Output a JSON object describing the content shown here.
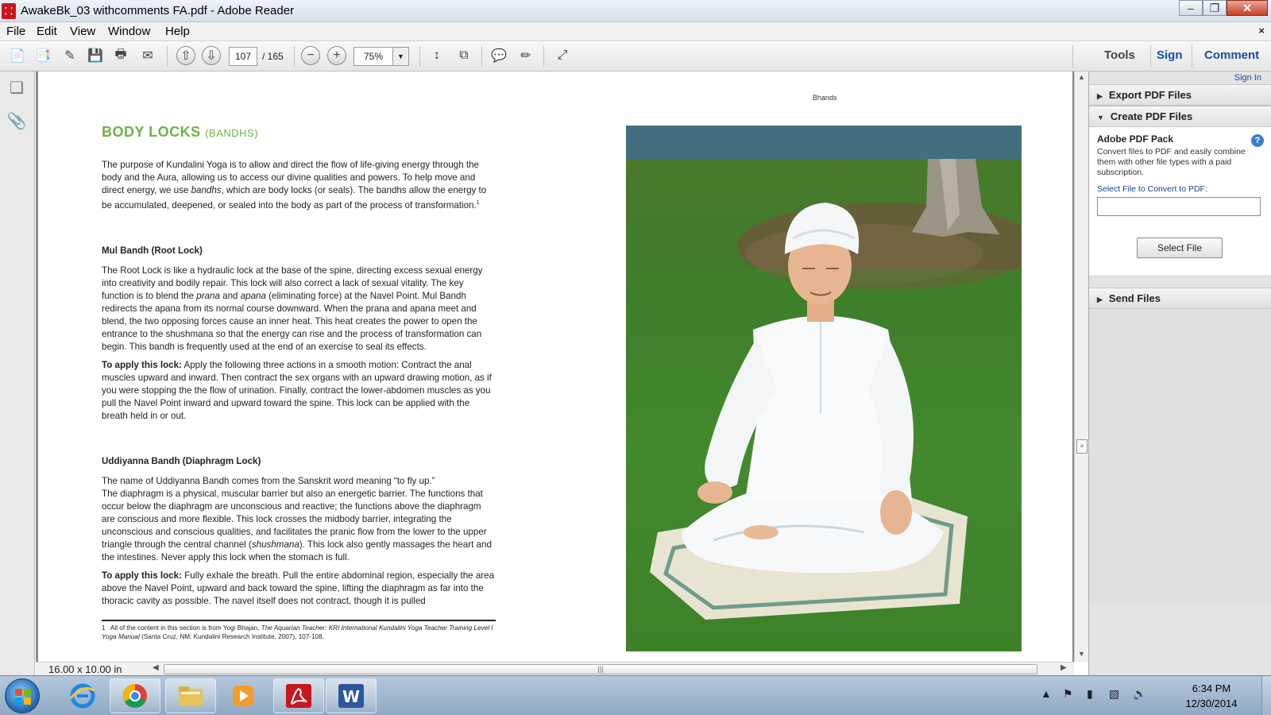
{
  "window": {
    "title": "AwakeBk_03 withcomments FA.pdf - Adobe Reader",
    "app_icon": "adobe-pdf-icon",
    "controls": [
      "minimize",
      "restore",
      "close"
    ]
  },
  "menu": {
    "items": [
      "File",
      "Edit",
      "View",
      "Window",
      "Help"
    ],
    "close_glyph": "×"
  },
  "toolbar": {
    "page_current": "107",
    "page_total": "/ 165",
    "zoom": "75%",
    "tools_label": "Tools",
    "sign_label": "Sign",
    "comment_label": "Comment"
  },
  "document": {
    "running_head": "Bhands",
    "title": "BODY LOCKS",
    "title_sub": "(BANDHS)",
    "intro_1": "The purpose of Kundalini Yoga is to allow and direct the flow of life-giving energy through the body and the Aura, allowing us to access our divine qualities and powers. To help move and direct energy, we use ",
    "intro_em": "bandhs",
    "intro_2": ", which are body locks (or seals). The bandhs allow the energy to be accumulated, deepened, or sealed into the body as part of the process of transformation.",
    "intro_sup": "1",
    "mul_heading": "Mul Bandh (Root Lock)",
    "mul_p1_a": "The Root Lock is like a hydraulic lock at the base of the spine, directing excess sexual energy into creativity and bodily repair. This lock will also correct a lack of sexual vitality. The key function is to blend the ",
    "mul_p1_em1": "prana",
    "mul_p1_b": " and ",
    "mul_p1_em2": "apana",
    "mul_p1_c": " (eliminating force) at the Navel Point. Mul Bandh redirects the apana from its normal course downward. When the prana and apana meet and blend, the two opposing forces cause an inner heat. This heat creates the power to open the entrance to the shushmana so that the energy can rise and the process of transformation can begin. This bandh is frequently used at the end of an exercise to seal its effects.",
    "mul_apply_label": "To apply this lock:",
    "mul_apply_text": " Apply the following three actions in a smooth motion: Contract the anal muscles upward and inward. Then contract the sex organs with an upward drawing motion, as if you were stopping the the flow of urination. Finally, contract the lower-abdomen muscles as you pull the Navel Point inward and upward toward the spine. This lock can be applied with the breath held in or out.",
    "udd_heading": "Uddiyanna Bandh (Diaphragm Lock)",
    "udd_p1": "The name of Uddiyanna Bandh comes from the Sanskrit word meaning “to fly up.”",
    "udd_p2_a": "The diaphragm is a physical, muscular barrier but also an energetic barrier. The functions that occur below the diaphragm are unconscious and reactive; the functions above the diaphragm are conscious and more flexible. This lock crosses the midbody barrier, integrating the unconscious and conscious qualities, and facilitates the pranic flow from the lower to the upper triangle through the central channel (",
    "udd_p2_em": "shushmana",
    "udd_p2_b": "). This lock also gently massages the heart and the intestines. Never apply this lock when the stomach is full.",
    "udd_apply_label": "To apply this lock:",
    "udd_apply_text": " Fully exhale the breath. Pull the entire abdominal region, especially the area above the Navel Point, upward and back toward the spine, lifting the diaphragm as far into the thoracic cavity as possible. The navel itself does not contract, though it is pulled",
    "footnote_num": "1",
    "footnote_a": "All of the content in this section is from Yogi Bhajan, ",
    "footnote_em": "The Aquarian Teacher: KRI International Kundalini Yoga Teacher Training Level I Yoga Manual",
    "footnote_b": " (Santa Cruz, NM: Kundalini Research Institute, 2007), 107-108.",
    "page_size": "16.00 x 10.00 in"
  },
  "right_panel": {
    "sign_in": "Sign In",
    "export_label": "Export PDF Files",
    "create_label": "Create PDF Files",
    "pack_title": "Adobe PDF Pack",
    "pack_desc": "Convert files to PDF and easily combine them with other file types with a paid subscription.",
    "select_label": "Select File to Convert to PDF:",
    "select_button": "Select File",
    "send_label": "Send Files"
  },
  "taskbar": {
    "time": "6:34 PM",
    "date": "12/30/2014",
    "apps": [
      "internet-explorer",
      "chrome",
      "file-explorer",
      "media-player",
      "adobe-reader",
      "word"
    ]
  },
  "colors": {
    "heading_green": "#6db346",
    "photo_band": "#426e80",
    "link_blue": "#1a4fa0"
  }
}
